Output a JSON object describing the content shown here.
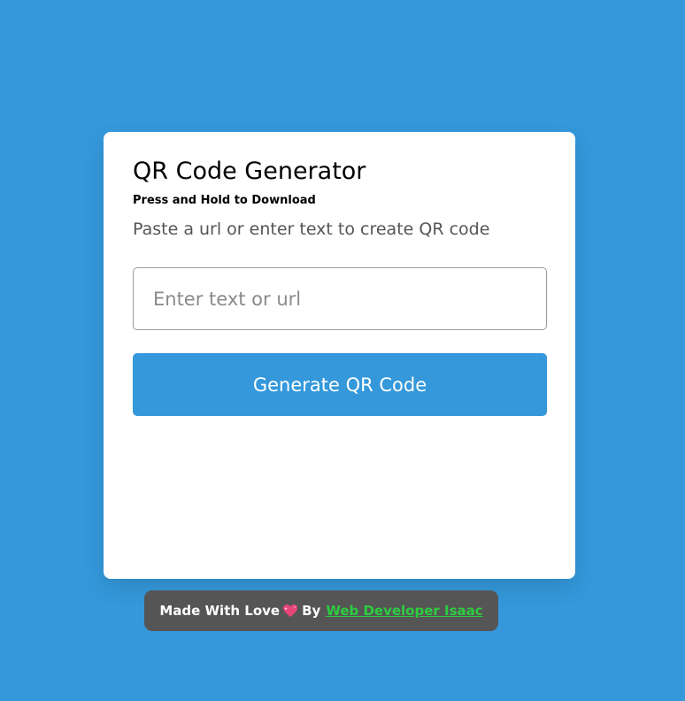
{
  "card": {
    "title": "QR Code Generator",
    "subtitle": "Press and Hold to Download",
    "description": "Paste a url or enter text to create QR code",
    "input": {
      "value": "",
      "placeholder": "Enter text or url"
    },
    "button_label": "Generate QR Code"
  },
  "credit": {
    "prefix": "Made With Love",
    "icon": "sparkling-heart-icon",
    "by": "By",
    "link_text": "Web Developer Isaac"
  },
  "colors": {
    "background": "#3498db",
    "button": "#3498db",
    "credit_bg": "#555555",
    "link": "#2ecc40"
  }
}
